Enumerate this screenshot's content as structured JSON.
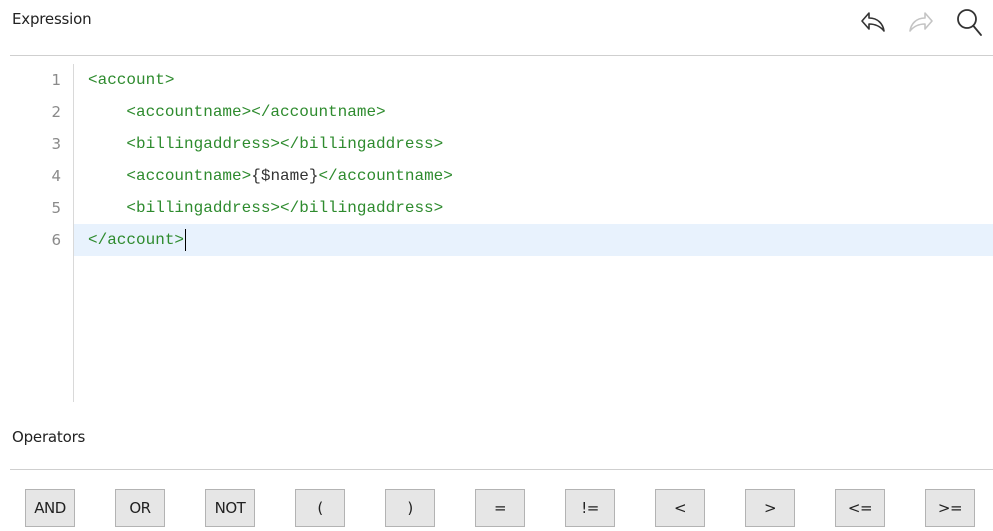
{
  "expression": {
    "title": "Expression",
    "toolbar": {
      "undo_icon": "undo-icon",
      "redo_icon": "redo-icon",
      "search_icon": "search-icon"
    },
    "lines": [
      {
        "number": "1",
        "indent": "",
        "before": "<account>",
        "var": "",
        "after": ""
      },
      {
        "number": "2",
        "indent": "    ",
        "before": "<accountname></accountname>",
        "var": "",
        "after": ""
      },
      {
        "number": "3",
        "indent": "    ",
        "before": "<billingaddress></billingaddress>",
        "var": "",
        "after": ""
      },
      {
        "number": "4",
        "indent": "    ",
        "before": "<accountname>",
        "var": "{$name}",
        "after": "</accountname>"
      },
      {
        "number": "5",
        "indent": "    ",
        "before": "<billingaddress></billingaddress>",
        "var": "",
        "after": ""
      },
      {
        "number": "6",
        "indent": "",
        "before": "</account>",
        "var": "",
        "after": ""
      }
    ],
    "active_line": 6,
    "colors": {
      "tag": "#2e8b2e",
      "variable": "#333333",
      "active_line_bg": "#e8f2fd"
    }
  },
  "operators": {
    "title": "Operators",
    "buttons": [
      "AND",
      "OR",
      "NOT",
      "(",
      ")",
      "=",
      "!=",
      "<",
      ">",
      "<=",
      ">="
    ]
  }
}
